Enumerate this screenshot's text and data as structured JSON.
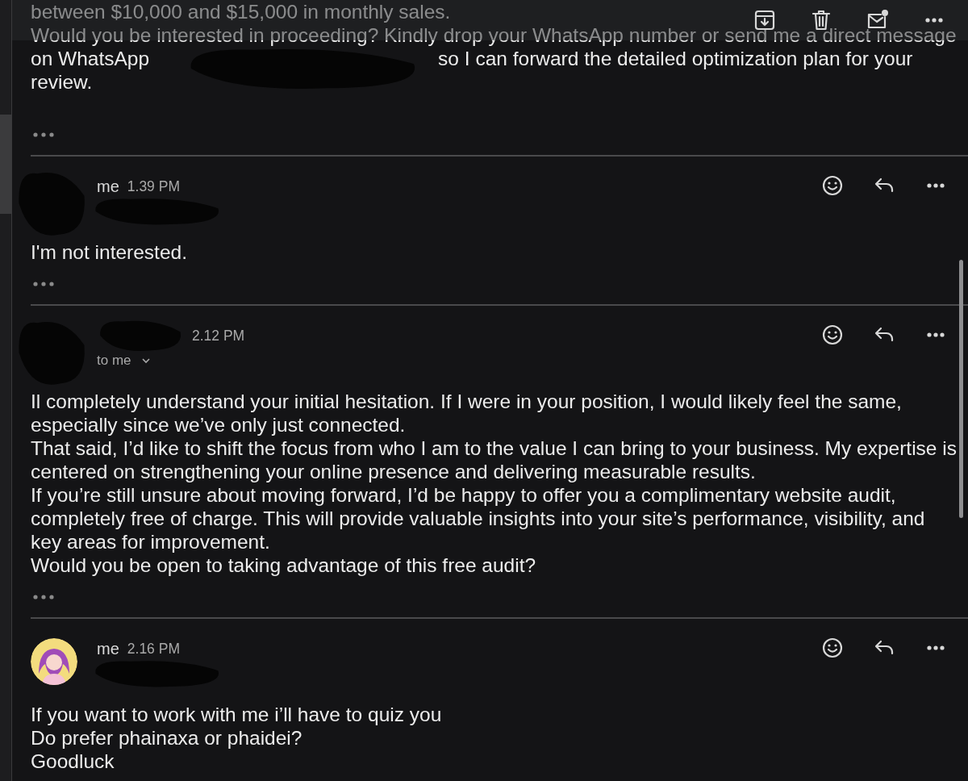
{
  "toolbar": {
    "actions": [
      {
        "kind": "archive"
      },
      {
        "kind": "delete"
      },
      {
        "kind": "mark-unread"
      },
      {
        "kind": "more"
      }
    ]
  },
  "messages": [
    {
      "lines": [
        [
          "between $10,000 and $15,000 in monthly sales."
        ],
        [
          "Would you be interested in proceeding? Kindly drop your WhatsApp number or send me a direct message"
        ],
        [
          "on WhatsApp",
          "so I can forward the detailed optimization plan for your"
        ],
        [
          "review."
        ]
      ],
      "redacted": true,
      "quoted_text": true
    },
    {
      "avatar": {
        "kind": "redacted"
      },
      "sender": "me",
      "time": "1.39 PM",
      "lines": [
        [
          "I'm not interested."
        ]
      ],
      "quoted_text": true
    },
    {
      "avatar": {
        "kind": "redacted"
      },
      "time": "2.12 PM",
      "recipient": "to me",
      "lines": [
        [
          "Il completely understand your initial hesitation. If I were in your position, I would likely feel the same,"
        ],
        [
          "especially since we’ve only just connected."
        ],
        [
          "That said, I’d like to shift the focus from who I am to the value I can bring to your business. My expertise is"
        ],
        [
          "centered on strengthening your online presence and delivering measurable results."
        ],
        [
          "If you’re still unsure about moving forward, I’d be happy to offer you a complimentary website audit,"
        ],
        [
          "completely free of charge. This will provide valuable insights into your site’s performance, visibility, and"
        ],
        [
          "key areas for improvement."
        ],
        [
          "Would you be open to taking advantage of this free audit?"
        ]
      ],
      "quoted_text": true
    },
    {
      "avatar": {
        "kind": "picture"
      },
      "sender": "me",
      "time": "2.16 PM",
      "lines": [
        [
          "If you want to work with me i’ll have to quiz you"
        ],
        [
          "Do prefer phainaxa or phaidei?"
        ],
        [
          "Goodluck"
        ]
      ]
    }
  ]
}
